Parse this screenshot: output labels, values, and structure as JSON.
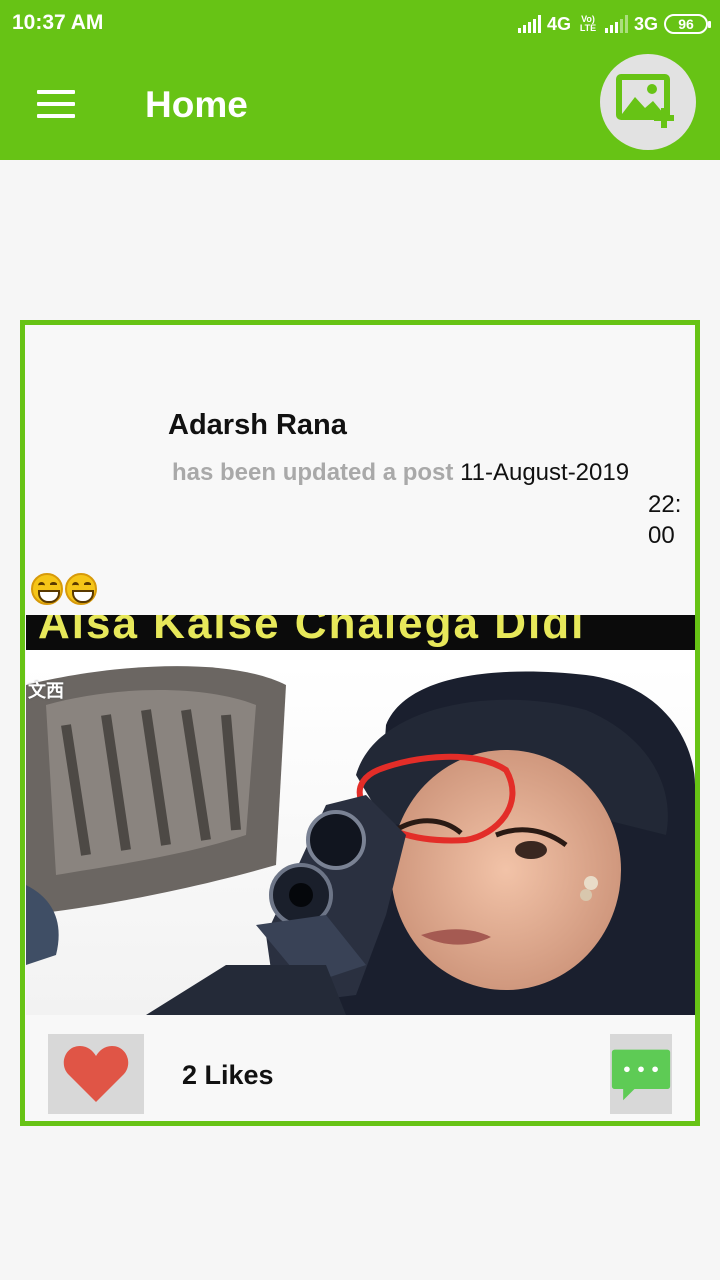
{
  "status_bar": {
    "time": "10:37 AM",
    "network1": "4G",
    "volte_top": "Vo)",
    "volte_bottom": "LTE",
    "network2": "3G",
    "battery": "96"
  },
  "app_bar": {
    "title": "Home",
    "menu_icon": "hamburger-menu-icon",
    "add_photo_icon": "add-photo-icon"
  },
  "post": {
    "author": "Adarsh Rana",
    "action_text": "has been updated a post",
    "date": "11-August-2019",
    "time": "22:00",
    "caption_emojis": [
      "grinning-squinting-face",
      "grinning-squinting-face"
    ],
    "image": {
      "title_text": "Aisa Kaise Chalega Didi",
      "watermark": "文西"
    },
    "likes_label": "2 Likes",
    "like_icon": "heart-icon",
    "comment_icon": "comment-bubble-icon"
  },
  "colors": {
    "primary": "#67c315",
    "like": "#e05546",
    "comment": "#5ecb55"
  }
}
